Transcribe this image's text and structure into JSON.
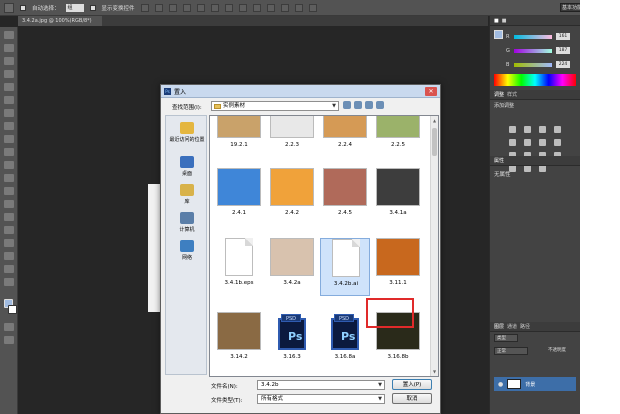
{
  "options_bar": {
    "auto_select_label": "自动选择：",
    "auto_select_value": "组",
    "transform_controls_label": "显示变换控件",
    "workspace_button": "基本功能"
  },
  "tab": {
    "label": "3.4.2a.jpg @ 100%(RGB/8*)"
  },
  "panels": {
    "color": {
      "rows": [
        {
          "label": "R",
          "value": "161"
        },
        {
          "label": "G",
          "value": "187"
        },
        {
          "label": "B",
          "value": "224"
        }
      ]
    },
    "adjustments": {
      "tab": "调整",
      "tab2": "样式",
      "hint": "添加调整"
    },
    "properties": {
      "tab": "属性",
      "content": "无属性"
    },
    "layers": {
      "tabs": [
        "图层",
        "通道",
        "路径"
      ],
      "kind": "类型",
      "mode": "正常",
      "opacity_label": "不透明度",
      "layer_name": "背景"
    }
  },
  "dialog": {
    "title": "置入",
    "look_in_label": "查找范围(I):",
    "look_in_value": "实例素材",
    "places": [
      {
        "label": "最近访问的位置",
        "color": "#e4b640"
      },
      {
        "label": "桌面",
        "color": "#3a6fbd"
      },
      {
        "label": "库",
        "color": "#d8b24a"
      },
      {
        "label": "计算机",
        "color": "#5a7ea8"
      },
      {
        "label": "网络",
        "color": "#3e7fc1"
      }
    ],
    "files": [
      {
        "label": "19.2.1",
        "kind": "image",
        "color": "#c9a26a"
      },
      {
        "label": "2.2.3",
        "kind": "image",
        "color": "#e8e8e8"
      },
      {
        "label": "2.2.4",
        "kind": "image",
        "color": "#d59a55"
      },
      {
        "label": "2.2.5",
        "kind": "image",
        "color": "#9bb26a"
      },
      {
        "label": "2.4.1",
        "kind": "image",
        "color": "#3f86d8"
      },
      {
        "label": "2.4.2",
        "kind": "image",
        "color": "#f0a23a"
      },
      {
        "label": "2.4.5",
        "kind": "image",
        "color": "#b06a5a"
      },
      {
        "label": "3.4.1a",
        "kind": "image",
        "color": "#3d3d3d"
      },
      {
        "label": "3.4.1b.eps",
        "kind": "doc"
      },
      {
        "label": "3.4.2a",
        "kind": "image",
        "color": "#d8c2ae"
      },
      {
        "label": "3.4.2b.ai",
        "kind": "doc",
        "selected": true
      },
      {
        "label": "3.11.1",
        "kind": "image",
        "color": "#c8681e"
      },
      {
        "label": "3.14.2",
        "kind": "image",
        "color": "#8a6a44"
      },
      {
        "label": "3.16.3",
        "kind": "psd",
        "tag": "PSD",
        "mark": "Ps"
      },
      {
        "label": "3.16.8a",
        "kind": "psd",
        "tag": "PSD",
        "mark": "Ps"
      },
      {
        "label": "3.16.8b",
        "kind": "image",
        "color": "#2a2a1a"
      }
    ],
    "file_name_label": "文件名(N):",
    "file_name_value": "3.4.2b",
    "file_type_label": "文件类型(T):",
    "file_type_value": "所有格式",
    "place_button": "置入(P)",
    "cancel_button": "取消"
  }
}
